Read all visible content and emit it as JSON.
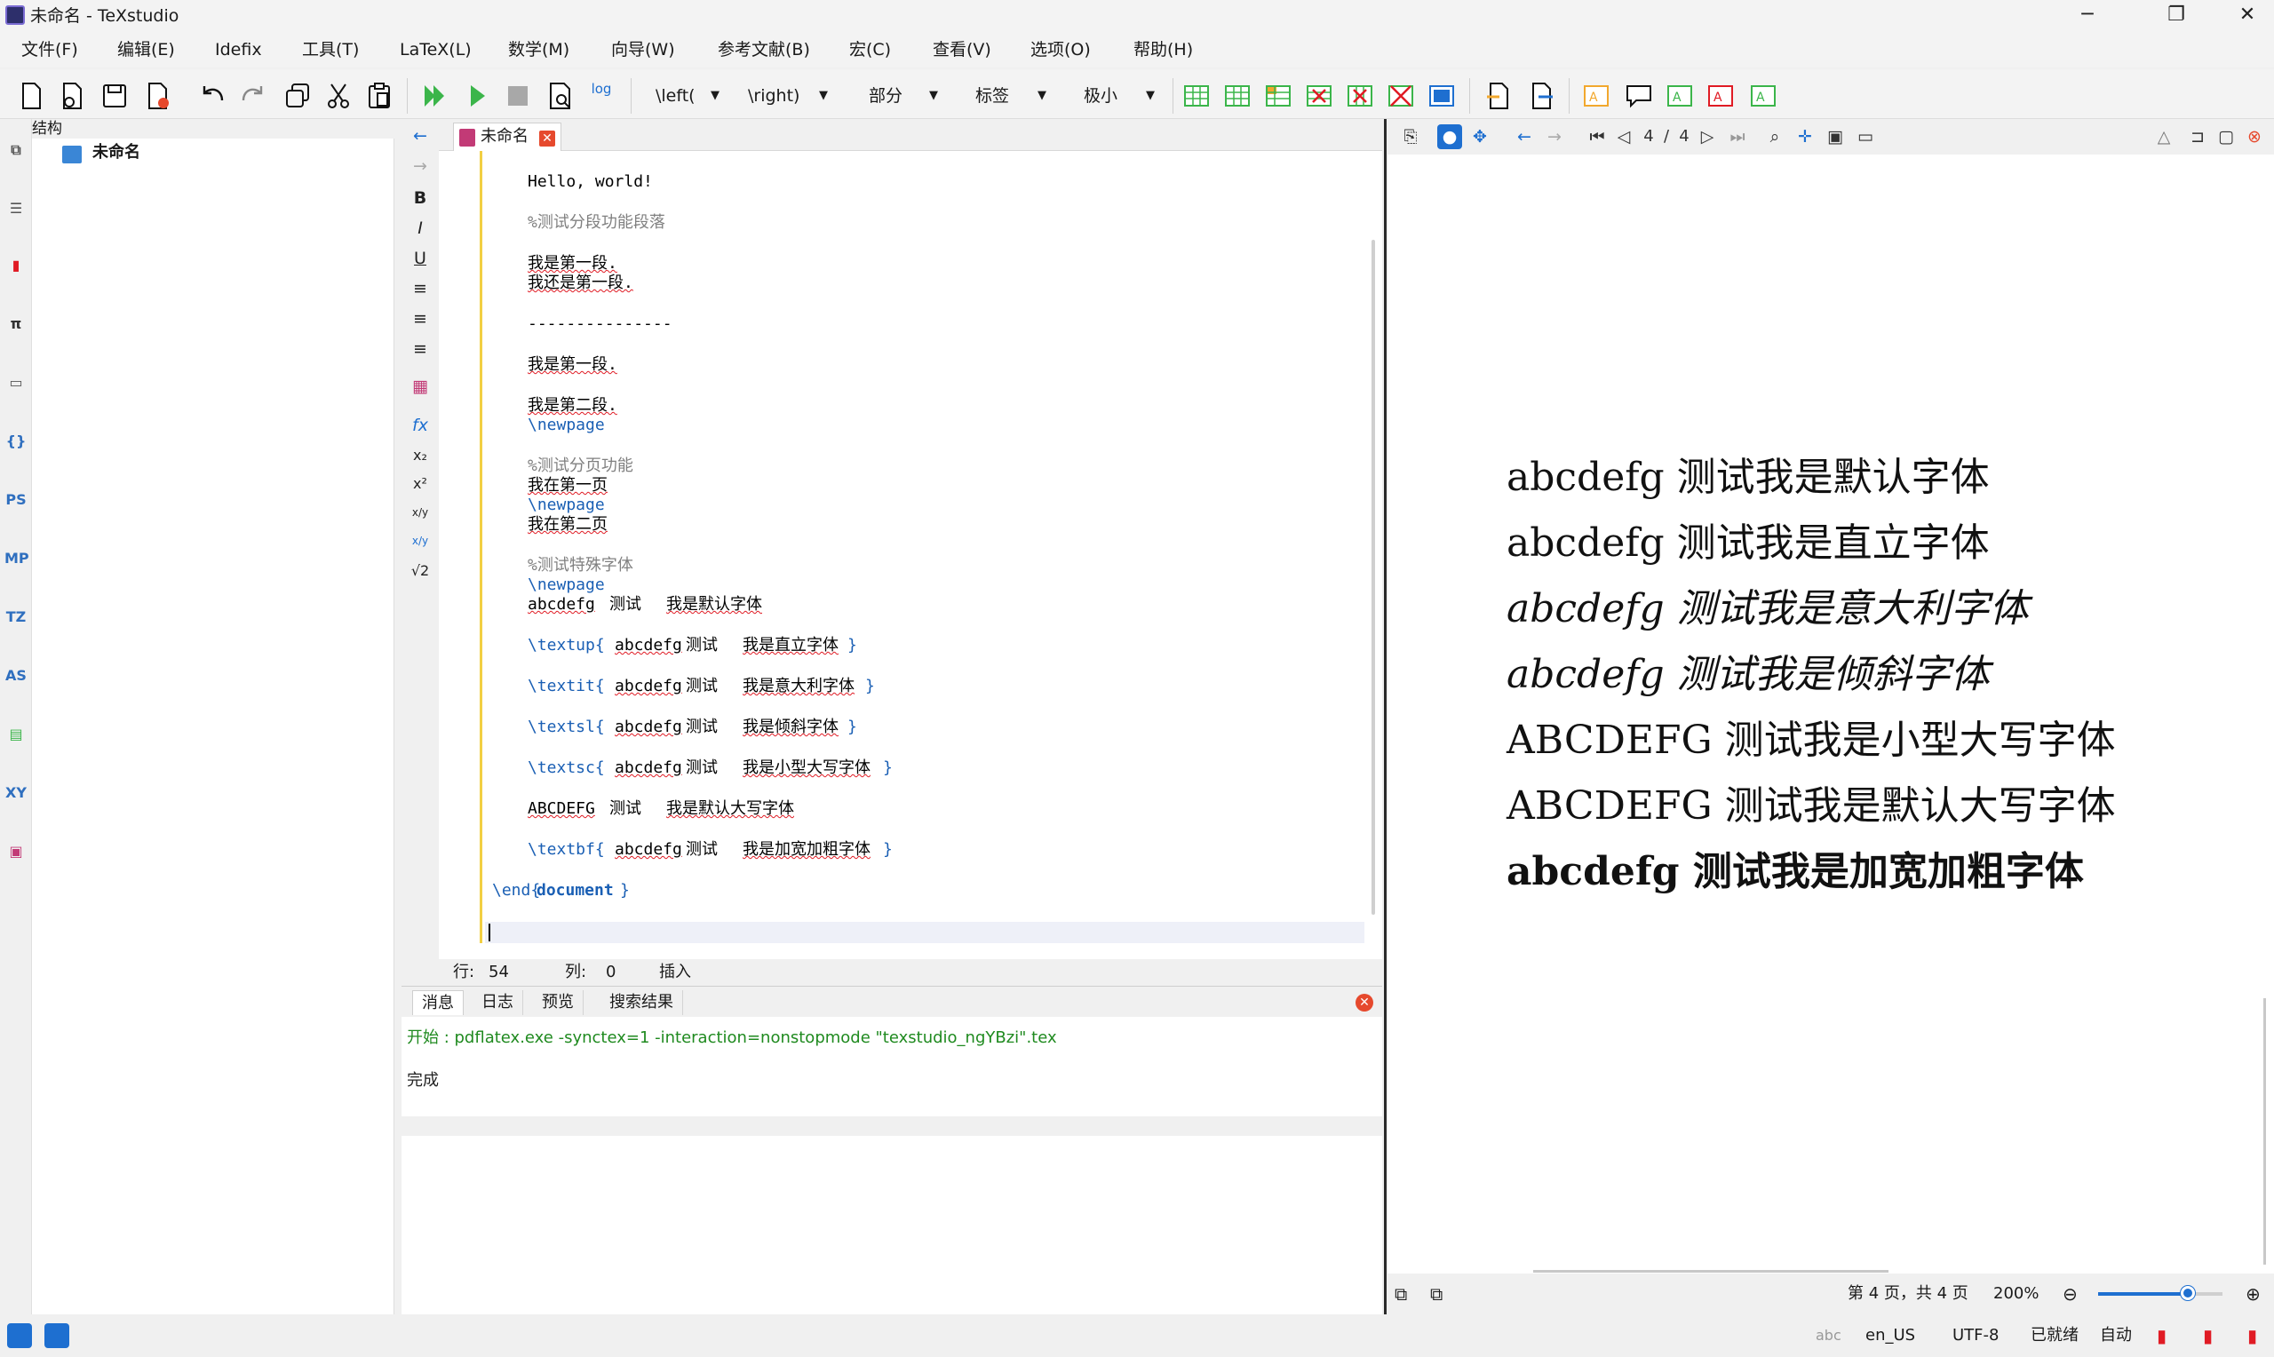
{
  "window": {
    "title": "未命名 - TeXstudio",
    "controls": [
      "─",
      "❐",
      "✕"
    ]
  },
  "menubar": {
    "items": [
      "文件(F)",
      "编辑(E)",
      "Idefix",
      "工具(T)",
      "LaTeX(L)",
      "数学(M)",
      "向导(W)",
      "参考文献(B)",
      "宏(C)",
      "查看(V)",
      "选项(O)",
      "帮助(H)"
    ]
  },
  "toolbar": {
    "combos": [
      "\\left(",
      "\\right)",
      "部分",
      "标签",
      "极小"
    ],
    "log_label": "log"
  },
  "structure": {
    "header": "结构",
    "root": "未命名"
  },
  "dock_icons": [
    "structure-icon",
    "todo-icon",
    "bookmarks-icon",
    "symbols-icon",
    "files-icon",
    "brackets-icon",
    "PS",
    "MP",
    "TZ",
    "AS",
    "table-icon",
    "XY",
    "graphics-icon"
  ],
  "dock_labels": {
    "ps": "PS",
    "mp": "MP",
    "tz": "TZ",
    "as": "AS",
    "xy": "XY"
  },
  "format_icons": {
    "bold": "B",
    "italic": "I",
    "underline": "U",
    "fx": "fx",
    "sub": "x₂",
    "sup": "x²",
    "frac": "x/y",
    "dfrac": "x/y",
    "sqrt": "√2"
  },
  "editor": {
    "tab_label": "未命名",
    "lines": {
      "l1": "Hello, world!",
      "l2": "%测试分段功能段落",
      "l3": "我是第一段.",
      "l4": "我还是第一段.",
      "l5": "---------------",
      "l6": "我是第一段.",
      "l7": "我是第二段.",
      "l8": "\\newpage",
      "l9": "%测试分页功能",
      "l10": "我在第一页",
      "l11": "\\newpage",
      "l12": "我在第二页",
      "l13": "%测试特殊字体",
      "l14": "\\newpage",
      "l15a": "abcdefg",
      "l15b": "测试",
      "l15c": "我是默认字体",
      "l16a": "\\textup{",
      "l16b": "abcdefg",
      "l16c": "测试",
      "l16d": "我是直立字体",
      "l16e": "}",
      "l17a": "\\textit{",
      "l17b": "abcdefg",
      "l17c": "测试",
      "l17d": "我是意大利字体",
      "l17e": "}",
      "l18a": "\\textsl{",
      "l18b": "abcdefg",
      "l18c": "测试",
      "l18d": "我是倾斜字体",
      "l18e": "}",
      "l19a": "\\textsc{",
      "l19b": "abcdefg",
      "l19c": "测试",
      "l19d": "我是小型大写字体",
      "l19e": "}",
      "l20a": "ABCDEFG",
      "l20b": "测试",
      "l20c": "我是默认大写字体",
      "l21a": "\\textbf{",
      "l21b": "abcdefg",
      "l21c": "测试",
      "l21d": "我是加宽加粗字体",
      "l21e": "}",
      "l22a": "\\end{",
      "l22b": "document",
      "l22c": "}"
    },
    "status": {
      "row_label": "行:",
      "row": "54",
      "col_label": "列:",
      "col": "0",
      "mode": "插入"
    }
  },
  "messages": {
    "tabs": [
      "消息",
      "日志",
      "预览",
      "搜索结果"
    ],
    "line1": "开始 : pdflatex.exe -synctex=1 -interaction=nonstopmode \"texstudio_ngYBzi\".tex",
    "line2": "完成"
  },
  "pdf": {
    "page_current": "4",
    "page_sep": "/",
    "page_total": "4",
    "lines": {
      "p1": "abcdefg 测试我是默认字体",
      "p2": "abcdefg 测试我是直立字体",
      "p3": "abcdefg 测试我是意大利字体",
      "p4": "abcdefg 测试我是倾斜字体",
      "p5": "ABCDEFG 测试我是小型大写字体",
      "p6": "ABCDEFG 测试我是默认大写字体",
      "p7": "abcdefg 测试我是加宽加粗字体"
    },
    "status_page": "第 4 页，共 4 页",
    "zoom": "200%",
    "zoom_slider_fraction": 0.72
  },
  "statusbar": {
    "spell": "abc",
    "lang": "en_US",
    "encoding": "UTF-8",
    "ready": "已就绪",
    "auto": "自动"
  },
  "colors": {
    "accent": "#1e6fd0",
    "error": "#e6492d",
    "green": "#3bb54a",
    "comment": "#808080"
  }
}
